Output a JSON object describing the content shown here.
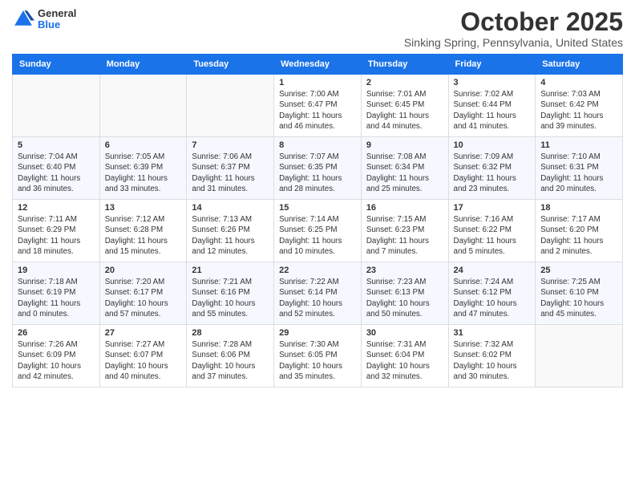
{
  "logo": {
    "general": "General",
    "blue": "Blue"
  },
  "header": {
    "month": "October 2025",
    "location": "Sinking Spring, Pennsylvania, United States"
  },
  "weekdays": [
    "Sunday",
    "Monday",
    "Tuesday",
    "Wednesday",
    "Thursday",
    "Friday",
    "Saturday"
  ],
  "weeks": [
    [
      {
        "day": "",
        "info": ""
      },
      {
        "day": "",
        "info": ""
      },
      {
        "day": "",
        "info": ""
      },
      {
        "day": "1",
        "info": "Sunrise: 7:00 AM\nSunset: 6:47 PM\nDaylight: 11 hours and 46 minutes."
      },
      {
        "day": "2",
        "info": "Sunrise: 7:01 AM\nSunset: 6:45 PM\nDaylight: 11 hours and 44 minutes."
      },
      {
        "day": "3",
        "info": "Sunrise: 7:02 AM\nSunset: 6:44 PM\nDaylight: 11 hours and 41 minutes."
      },
      {
        "day": "4",
        "info": "Sunrise: 7:03 AM\nSunset: 6:42 PM\nDaylight: 11 hours and 39 minutes."
      }
    ],
    [
      {
        "day": "5",
        "info": "Sunrise: 7:04 AM\nSunset: 6:40 PM\nDaylight: 11 hours and 36 minutes."
      },
      {
        "day": "6",
        "info": "Sunrise: 7:05 AM\nSunset: 6:39 PM\nDaylight: 11 hours and 33 minutes."
      },
      {
        "day": "7",
        "info": "Sunrise: 7:06 AM\nSunset: 6:37 PM\nDaylight: 11 hours and 31 minutes."
      },
      {
        "day": "8",
        "info": "Sunrise: 7:07 AM\nSunset: 6:35 PM\nDaylight: 11 hours and 28 minutes."
      },
      {
        "day": "9",
        "info": "Sunrise: 7:08 AM\nSunset: 6:34 PM\nDaylight: 11 hours and 25 minutes."
      },
      {
        "day": "10",
        "info": "Sunrise: 7:09 AM\nSunset: 6:32 PM\nDaylight: 11 hours and 23 minutes."
      },
      {
        "day": "11",
        "info": "Sunrise: 7:10 AM\nSunset: 6:31 PM\nDaylight: 11 hours and 20 minutes."
      }
    ],
    [
      {
        "day": "12",
        "info": "Sunrise: 7:11 AM\nSunset: 6:29 PM\nDaylight: 11 hours and 18 minutes."
      },
      {
        "day": "13",
        "info": "Sunrise: 7:12 AM\nSunset: 6:28 PM\nDaylight: 11 hours and 15 minutes."
      },
      {
        "day": "14",
        "info": "Sunrise: 7:13 AM\nSunset: 6:26 PM\nDaylight: 11 hours and 12 minutes."
      },
      {
        "day": "15",
        "info": "Sunrise: 7:14 AM\nSunset: 6:25 PM\nDaylight: 11 hours and 10 minutes."
      },
      {
        "day": "16",
        "info": "Sunrise: 7:15 AM\nSunset: 6:23 PM\nDaylight: 11 hours and 7 minutes."
      },
      {
        "day": "17",
        "info": "Sunrise: 7:16 AM\nSunset: 6:22 PM\nDaylight: 11 hours and 5 minutes."
      },
      {
        "day": "18",
        "info": "Sunrise: 7:17 AM\nSunset: 6:20 PM\nDaylight: 11 hours and 2 minutes."
      }
    ],
    [
      {
        "day": "19",
        "info": "Sunrise: 7:18 AM\nSunset: 6:19 PM\nDaylight: 11 hours and 0 minutes."
      },
      {
        "day": "20",
        "info": "Sunrise: 7:20 AM\nSunset: 6:17 PM\nDaylight: 10 hours and 57 minutes."
      },
      {
        "day": "21",
        "info": "Sunrise: 7:21 AM\nSunset: 6:16 PM\nDaylight: 10 hours and 55 minutes."
      },
      {
        "day": "22",
        "info": "Sunrise: 7:22 AM\nSunset: 6:14 PM\nDaylight: 10 hours and 52 minutes."
      },
      {
        "day": "23",
        "info": "Sunrise: 7:23 AM\nSunset: 6:13 PM\nDaylight: 10 hours and 50 minutes."
      },
      {
        "day": "24",
        "info": "Sunrise: 7:24 AM\nSunset: 6:12 PM\nDaylight: 10 hours and 47 minutes."
      },
      {
        "day": "25",
        "info": "Sunrise: 7:25 AM\nSunset: 6:10 PM\nDaylight: 10 hours and 45 minutes."
      }
    ],
    [
      {
        "day": "26",
        "info": "Sunrise: 7:26 AM\nSunset: 6:09 PM\nDaylight: 10 hours and 42 minutes."
      },
      {
        "day": "27",
        "info": "Sunrise: 7:27 AM\nSunset: 6:07 PM\nDaylight: 10 hours and 40 minutes."
      },
      {
        "day": "28",
        "info": "Sunrise: 7:28 AM\nSunset: 6:06 PM\nDaylight: 10 hours and 37 minutes."
      },
      {
        "day": "29",
        "info": "Sunrise: 7:30 AM\nSunset: 6:05 PM\nDaylight: 10 hours and 35 minutes."
      },
      {
        "day": "30",
        "info": "Sunrise: 7:31 AM\nSunset: 6:04 PM\nDaylight: 10 hours and 32 minutes."
      },
      {
        "day": "31",
        "info": "Sunrise: 7:32 AM\nSunset: 6:02 PM\nDaylight: 10 hours and 30 minutes."
      },
      {
        "day": "",
        "info": ""
      }
    ]
  ]
}
